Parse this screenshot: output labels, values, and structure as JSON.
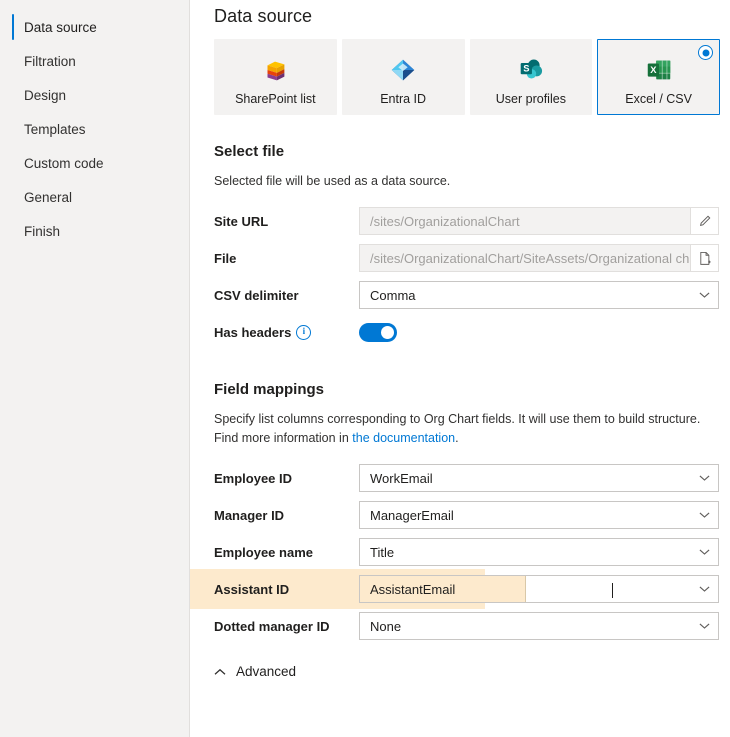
{
  "sidebar": {
    "items": [
      {
        "label": "Data source",
        "active": true
      },
      {
        "label": "Filtration",
        "active": false
      },
      {
        "label": "Design",
        "active": false
      },
      {
        "label": "Templates",
        "active": false
      },
      {
        "label": "Custom code",
        "active": false
      },
      {
        "label": "General",
        "active": false
      },
      {
        "label": "Finish",
        "active": false
      }
    ]
  },
  "main": {
    "title": "Data source",
    "sources": [
      {
        "label": "SharePoint list",
        "icon": "sharepoint-list-icon",
        "selected": false
      },
      {
        "label": "Entra ID",
        "icon": "entra-id-icon",
        "selected": false
      },
      {
        "label": "User profiles",
        "icon": "user-profiles-icon",
        "selected": false
      },
      {
        "label": "Excel / CSV",
        "icon": "excel-csv-icon",
        "selected": true
      }
    ],
    "select_file": {
      "title": "Select file",
      "description": "Selected file will be used as a data source.",
      "site_url_label": "Site URL",
      "site_url_value": "/sites/OrganizationalChart",
      "file_label": "File",
      "file_value": "/sites/OrganizationalChart/SiteAssets/Organizational chart.csv",
      "csv_delimiter_label": "CSV delimiter",
      "csv_delimiter_value": "Comma",
      "has_headers_label": "Has headers",
      "has_headers_value": "on"
    },
    "field_mappings": {
      "title": "Field mappings",
      "description_part1": "Specify list columns corresponding to Org Chart fields. It will use them to build structure. Find more information in ",
      "description_link": "the documentation",
      "description_part2": ".",
      "rows": [
        {
          "label": "Employee ID",
          "value": "WorkEmail",
          "highlight": false
        },
        {
          "label": "Manager ID",
          "value": "ManagerEmail",
          "highlight": false
        },
        {
          "label": "Employee name",
          "value": "Title",
          "highlight": false
        },
        {
          "label": "Assistant ID",
          "value": "AssistantEmail",
          "highlight": true
        },
        {
          "label": "Dotted manager ID",
          "value": "None",
          "highlight": false
        }
      ]
    },
    "advanced_label": "Advanced"
  },
  "colors": {
    "accent": "#0078d4",
    "highlight": "#fdeacd",
    "sidebar_bg": "#f3f2f1",
    "card_bg": "#f3f2f1"
  }
}
